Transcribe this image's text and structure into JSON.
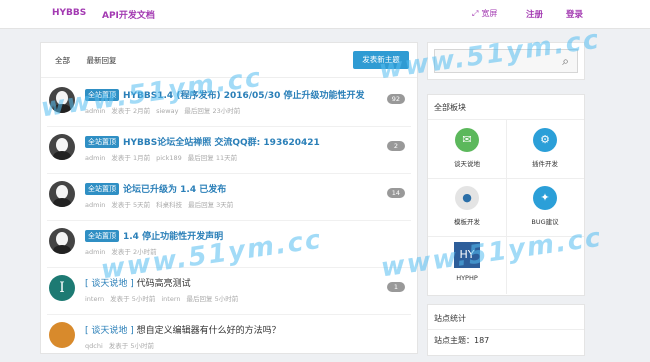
{
  "nav": {
    "brand": "HYBBS",
    "api_doc": "API开发文档",
    "wide_icon": "expand-icon",
    "wide": "宽屏",
    "register": "注册",
    "login": "登录"
  },
  "main": {
    "tabs": [
      "全部",
      "最新回复"
    ],
    "post_button": "发表新主题",
    "threads": [
      {
        "tag": "全站置顶",
        "title": "HYBBS1.4 (程序发布) 2016/05/30 停止升级功能性开发",
        "meta": [
          "admin",
          "发表于 2月前",
          "sieway",
          "最后回复 23小时前"
        ],
        "count": "92",
        "avatar": "face"
      },
      {
        "tag": "全站置顶",
        "title": "HYBBS论坛全站禅照 交流QQ群: 193620421",
        "meta": [
          "admin",
          "发表于 1月前",
          "pick189",
          "最后回复 11天前"
        ],
        "count": "2",
        "avatar": "face"
      },
      {
        "tag": "全站置顶",
        "title": "论坛已升级为 1.4 已发布",
        "meta": [
          "admin",
          "发表于 5天前",
          "科桌科技",
          "最后回复 3天前"
        ],
        "count": "14",
        "avatar": "face"
      },
      {
        "tag": "全站置顶",
        "title": "1.4 停止功能性开发声明",
        "meta": [
          "admin",
          "发表于 2小时前"
        ],
        "count": "",
        "avatar": "face"
      },
      {
        "tag": "[ 谈天说地 ]",
        "title": "代码高亮测试",
        "meta": [
          "intern",
          "发表于 5小时前",
          "intern",
          "最后回复 5小时前"
        ],
        "count": "1",
        "avatar": "teal",
        "avatar_letter": "I"
      },
      {
        "tag": "[ 谈天说地 ]",
        "title": "想自定义编辑器有什么好的方法吗？",
        "meta": [
          "qdchi",
          "发表于 5小时前"
        ],
        "count": "",
        "avatar": "orange"
      }
    ]
  },
  "search": {
    "icon": "search-icon"
  },
  "boards": {
    "header": "全部板块",
    "items": [
      {
        "label": "谈天说地",
        "icon": "chat-icon",
        "color": "#5cb85c",
        "glyph": "💬"
      },
      {
        "label": "插件开发",
        "icon": "gear-icon",
        "color": "#2b9fd8",
        "glyph": "⚙"
      },
      {
        "label": "模板开发",
        "icon": "template-icon",
        "color": "#ddd",
        "glyph": "●"
      },
      {
        "label": "BUG建议",
        "icon": "bulb-icon",
        "color": "#2b9fd8",
        "glyph": "💡"
      },
      {
        "label": "HYPHP",
        "icon": "hy-logo",
        "color": "#2d5e9a",
        "glyph": "HY"
      }
    ]
  },
  "stats": {
    "header": "站点统计",
    "topics": "站点主题：187"
  },
  "watermark": "www.51ym.cc"
}
